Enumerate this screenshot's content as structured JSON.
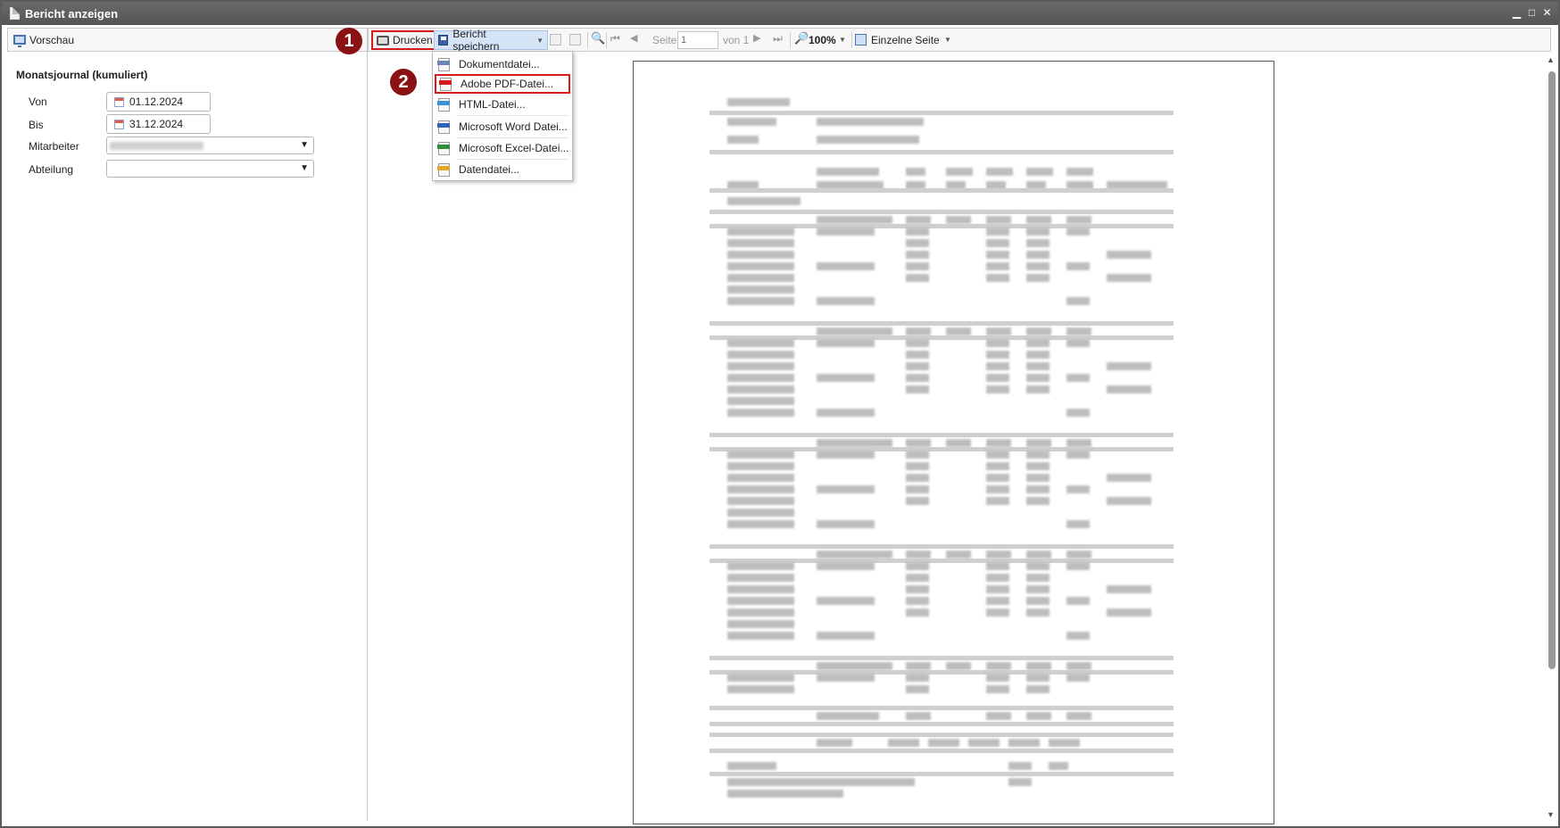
{
  "window": {
    "title": "Bericht anzeigen"
  },
  "left_panel": {
    "toolbar_label": "Vorschau",
    "report_title": "Monatsjournal (kumuliert)",
    "params": [
      {
        "label": "Von",
        "value": "01.12.2024"
      },
      {
        "label": "Bis",
        "value": "31.12.2024"
      },
      {
        "label": "Mitarbeiter",
        "value": ""
      },
      {
        "label": "Abteilung",
        "value": ""
      }
    ]
  },
  "toolbar": {
    "print_label": "Drucken",
    "save_label": "Bericht speichern",
    "page_label": "Seite",
    "page_value": "1",
    "page_of": "von 1",
    "zoom": "100%",
    "view_mode": "Einzelne Seite"
  },
  "save_menu": {
    "items": [
      {
        "label": "Dokumentdatei...",
        "icon": "document-file-icon",
        "color": "#6b87b5"
      },
      {
        "label": "Adobe PDF-Datei...",
        "icon": "pdf-file-icon",
        "color": "#d61a1a"
      },
      {
        "label": "HTML-Datei...",
        "icon": "html-file-icon",
        "color": "#3a92d8"
      },
      {
        "label": "Microsoft Word Datei...",
        "icon": "word-file-icon",
        "color": "#2d63b8"
      },
      {
        "label": "Microsoft Excel-Datei...",
        "icon": "excel-file-icon",
        "color": "#2f8f3a"
      },
      {
        "label": "Datendatei...",
        "icon": "data-file-icon",
        "color": "#e0a92a"
      }
    ]
  },
  "annotations": {
    "step1": "1",
    "step2": "2",
    "marker_color": "#8a1212",
    "highlight_color": "#d61a1a"
  }
}
